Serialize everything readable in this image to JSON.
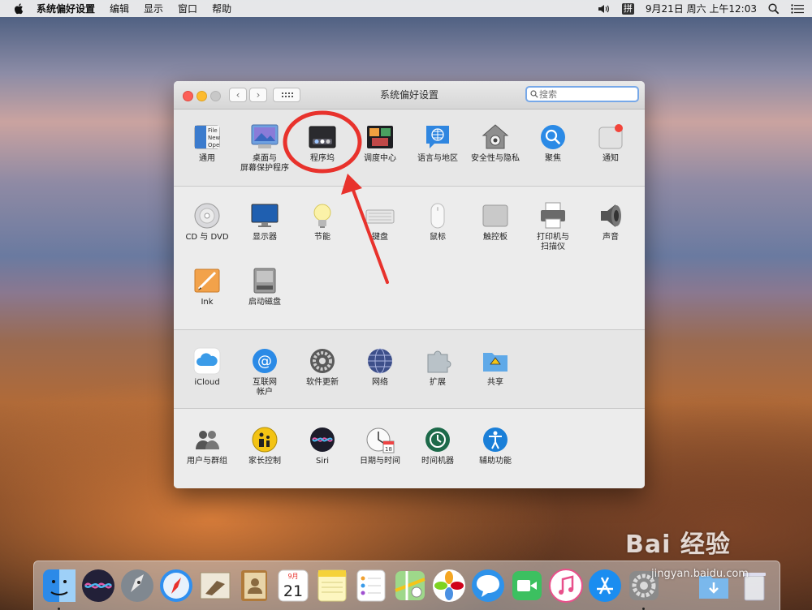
{
  "menubar": {
    "app_name": "系统偏好设置",
    "menus": [
      "编辑",
      "显示",
      "窗口",
      "帮助"
    ],
    "status": {
      "input_method": "拼",
      "datetime": "9月21日 周六 上午12:03"
    }
  },
  "window": {
    "title": "系统偏好设置",
    "search_placeholder": "搜索",
    "sections": [
      {
        "panes": [
          {
            "name": "general",
            "label": "通用"
          },
          {
            "name": "desktop-screensaver",
            "label": "桌面与",
            "label2": "屏幕保护程序"
          },
          {
            "name": "dock",
            "label": "程序坞"
          },
          {
            "name": "mission-control",
            "label": "调度中心"
          },
          {
            "name": "language-region",
            "label": "语言与地区"
          },
          {
            "name": "security-privacy",
            "label": "安全性与隐私"
          },
          {
            "name": "spotlight",
            "label": "聚焦"
          },
          {
            "name": "notifications",
            "label": "通知"
          }
        ]
      },
      {
        "panes": [
          {
            "name": "cds-dvds",
            "label": "CD 与 DVD"
          },
          {
            "name": "displays",
            "label": "显示器"
          },
          {
            "name": "energy-saver",
            "label": "节能"
          },
          {
            "name": "keyboard",
            "label": "键盘"
          },
          {
            "name": "mouse",
            "label": "鼠标"
          },
          {
            "name": "trackpad",
            "label": "触控板"
          },
          {
            "name": "printers-scanners",
            "label": "打印机与",
            "label2": "扫描仪"
          },
          {
            "name": "sound",
            "label": "声音"
          },
          {
            "name": "ink",
            "label": "Ink"
          },
          {
            "name": "startup-disk",
            "label": "启动磁盘"
          }
        ]
      },
      {
        "panes": [
          {
            "name": "icloud",
            "label": "iCloud"
          },
          {
            "name": "internet-accounts",
            "label": "互联网",
            "label2": "帐户"
          },
          {
            "name": "software-update",
            "label": "软件更新"
          },
          {
            "name": "network",
            "label": "网络"
          },
          {
            "name": "extensions",
            "label": "扩展"
          },
          {
            "name": "sharing",
            "label": "共享"
          }
        ]
      },
      {
        "panes": [
          {
            "name": "users-groups",
            "label": "用户与群组"
          },
          {
            "name": "parental-controls",
            "label": "家长控制"
          },
          {
            "name": "siri",
            "label": "Siri"
          },
          {
            "name": "date-time",
            "label": "日期与时间"
          },
          {
            "name": "time-machine",
            "label": "时间机器"
          },
          {
            "name": "accessibility",
            "label": "辅助功能"
          }
        ]
      }
    ]
  },
  "icon_text": {
    "general": [
      "File",
      "New",
      "Ope"
    ],
    "calendar_month": "9月",
    "calendar_day": "21",
    "date_time_day": "18"
  },
  "dock": {
    "apps": [
      "finder",
      "siri",
      "launchpad",
      "safari",
      "mail",
      "contacts",
      "calendar",
      "notes",
      "reminders",
      "maps",
      "photos",
      "messages",
      "facetime",
      "itunes",
      "app-store",
      "system-preferences",
      "downloads",
      "trash"
    ]
  },
  "watermark": {
    "brand": "Bai 经验",
    "url": "jingyan.baidu.com"
  },
  "colors": {
    "annotation": "#e8322c",
    "accent": "#77a8e8",
    "close": "#fc5f57",
    "minimize": "#fdbb2e"
  }
}
